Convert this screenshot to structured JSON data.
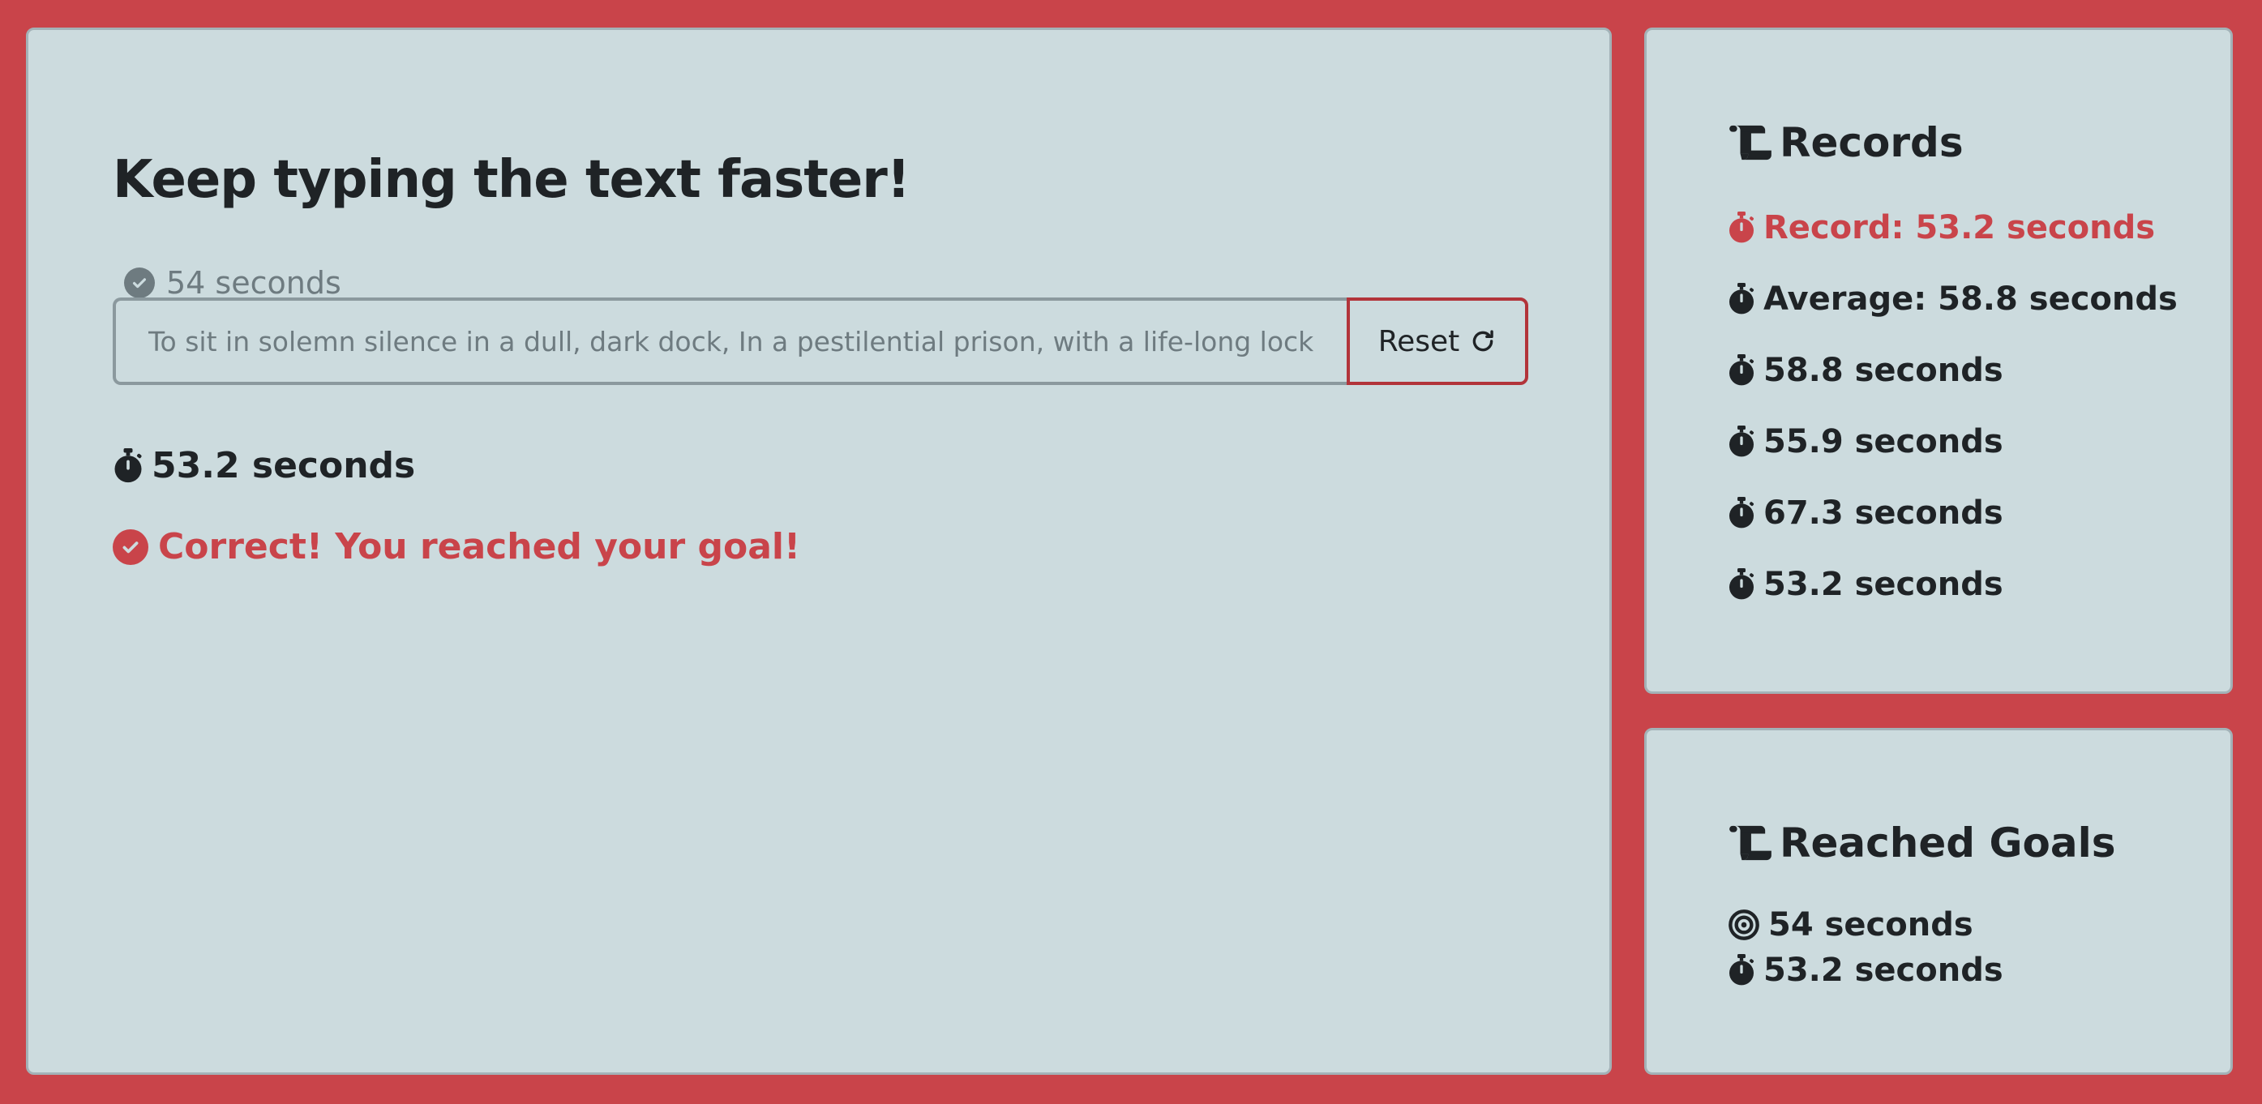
{
  "main": {
    "title": "Keep typing the text faster!",
    "goal_time": "54 seconds",
    "input_placeholder": "To sit in solemn silence in a dull, dark dock, In a pestilential prison, with a life-long lock,",
    "reset_label": "Reset",
    "current_time": "53.2 seconds",
    "success_message": "Correct! You reached your goal!"
  },
  "records": {
    "title": "Records",
    "record_label": "Record: 53.2 seconds",
    "average_label": "Average: 58.8 seconds",
    "times": [
      "58.8 seconds",
      "55.9 seconds",
      "67.3 seconds",
      "53.2 seconds"
    ]
  },
  "goals": {
    "title": "Reached Goals",
    "goal": "54 seconds",
    "time": "53.2 seconds"
  },
  "colors": {
    "background": "#c9444a",
    "card": "#ccdbde",
    "accent": "#c9444a",
    "muted": "#6e7b80",
    "text": "#1f2326"
  }
}
